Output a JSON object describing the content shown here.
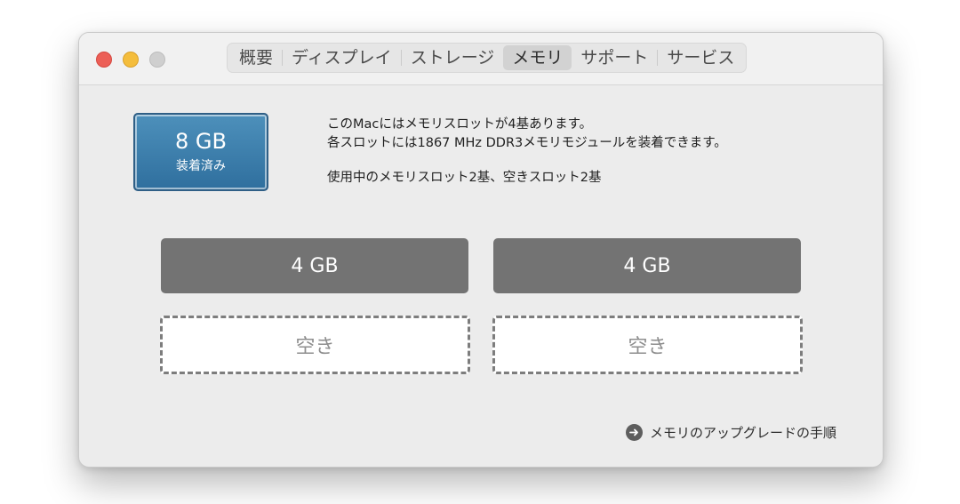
{
  "window": {
    "tabs": [
      {
        "label": "概要",
        "selected": false
      },
      {
        "label": "ディスプレイ",
        "selected": false
      },
      {
        "label": "ストレージ",
        "selected": false
      },
      {
        "label": "メモリ",
        "selected": true
      },
      {
        "label": "サポート",
        "selected": false
      },
      {
        "label": "サービス",
        "selected": false
      }
    ]
  },
  "memory": {
    "installed_size": "8 GB",
    "installed_caption": "装着済み",
    "info_line1": "このMacにはメモリスロットが4基あります。",
    "info_line2": "各スロットには1867 MHz DDR3メモリモジュールを装着できます。",
    "info_line3": "使用中のメモリスロット2基、空きスロット2基",
    "slots": [
      {
        "label": "4 GB",
        "state": "filled"
      },
      {
        "label": "4 GB",
        "state": "filled"
      },
      {
        "label": "空き",
        "state": "empty"
      },
      {
        "label": "空き",
        "state": "empty"
      }
    ],
    "upgrade_link": "メモリのアップグレードの手順"
  },
  "colors": {
    "badge": "#2f6f9e",
    "filled_slot": "#737373",
    "close": "#ec5f57",
    "minimize": "#f4bd3c",
    "zoom": "#cfcfcf"
  },
  "icons": {
    "upgrade_link": "arrow-circle-right-icon"
  }
}
